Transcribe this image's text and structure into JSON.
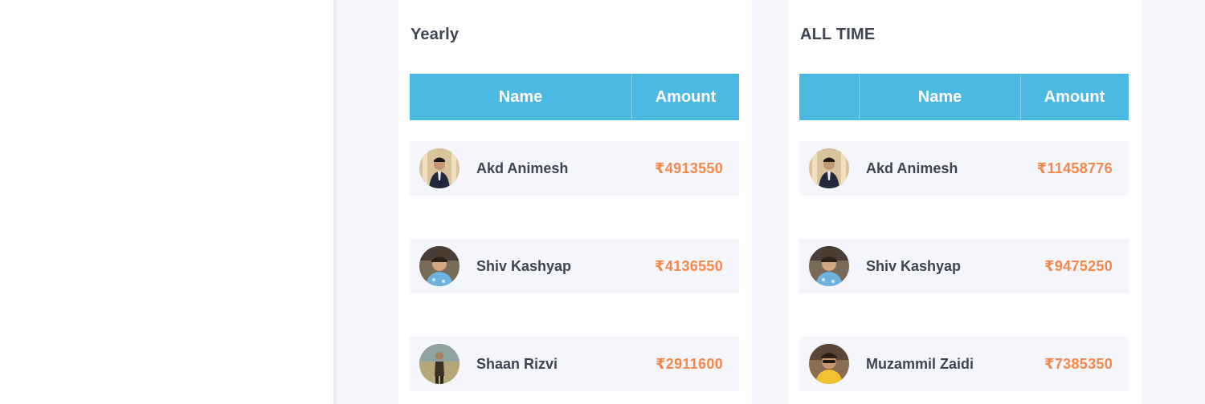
{
  "yearly": {
    "title": "Yearly",
    "headers": {
      "name": "Name",
      "amount": "Amount"
    },
    "rows": [
      {
        "name": "Akd Animesh",
        "amount": "₹4913550",
        "avatar": "person-suit-avatar"
      },
      {
        "name": "Shiv Kashyap",
        "amount": "₹4136550",
        "avatar": "person-blue-shirt-avatar"
      },
      {
        "name": "Shaan Rizvi",
        "amount": "₹2911600",
        "avatar": "person-outdoor-avatar"
      }
    ]
  },
  "alltime": {
    "title": "ALL TIME",
    "headers": {
      "name": "Name",
      "amount": "Amount"
    },
    "rows": [
      {
        "name": "Akd Animesh",
        "amount": "₹11458776",
        "avatar": "person-suit-avatar"
      },
      {
        "name": "Shiv Kashyap",
        "amount": "₹9475250",
        "avatar": "person-blue-shirt-avatar"
      },
      {
        "name": "Muzammil Zaidi",
        "amount": "₹7385350",
        "avatar": "person-sunglasses-avatar"
      }
    ]
  },
  "colors": {
    "header_bg": "#4cb9e5",
    "amount_text": "#f5874a",
    "row_bg": "#f5f5fc",
    "page_bg": "#f5f6fb"
  }
}
